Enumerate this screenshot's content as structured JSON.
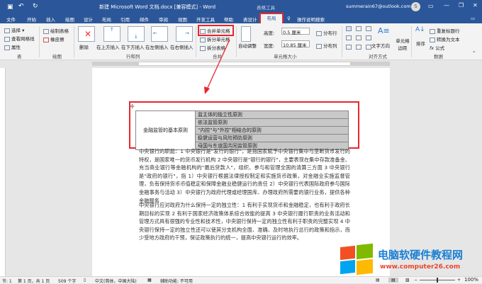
{
  "title_bar": {
    "document_title": "新建 Microsoft Word 文档.docx [兼容模式] - Word",
    "context_tools": "表格工具",
    "account": "summerain67@outlook.com",
    "avatar_letter": "S"
  },
  "menu_tabs": [
    "文件",
    "开始",
    "插入",
    "绘图",
    "设计",
    "布局",
    "引用",
    "邮件",
    "审阅",
    "视图",
    "开发工具",
    "帮助",
    "表设计",
    "布局"
  ],
  "active_tab": "布局",
  "search_label": "操作说明搜索",
  "ribbon": {
    "table_group": {
      "label": "表",
      "items": [
        "选择",
        "查看网格线",
        "属性"
      ]
    },
    "draw_group": {
      "label": "绘图",
      "items": [
        "绘制表格",
        "橡皮擦"
      ]
    },
    "rows_cols_group": {
      "label": "行和列",
      "delete": "删除",
      "insert_above": "在上方插入",
      "insert_below": "在下方插入",
      "insert_left": "在左侧插入",
      "insert_right": "在右侧插入"
    },
    "merge_group": {
      "label": "合并",
      "merge_cells": "合并单元格",
      "split_cells": "拆分单元格",
      "split_table": "拆分表格"
    },
    "cell_size_group": {
      "label": "单元格大小",
      "autofit": "自动调整",
      "height_label": "高度:",
      "height_value": "0.5 厘米",
      "width_label": "宽度:",
      "width_value": "10.85 厘米",
      "distribute_rows": "分布行",
      "distribute_cols": "分布列"
    },
    "alignment_group": {
      "label": "对齐方式",
      "text_direction": "文字方向",
      "cell_margins": "单元格边距"
    },
    "data_group": {
      "label": "数据",
      "sort": "排序",
      "repeat_header": "重复标题行",
      "convert_text": "转换为文本",
      "formula": "公式"
    }
  },
  "table": {
    "left_cell": "金融监管的基本原则",
    "rows": [
      "监主体的独立性原则",
      "依法监管原则",
      "\"内控\"与\"外控\"相结合的原则",
      "稳健运营与风险预防原则",
      "母国与东道国共同监管原则"
    ]
  },
  "paragraphs": [
    "中央银行的职能：1 中央银行是\"发行的银行\"，是指国家赋予中央银行集中与垄断货币发行的特权，是国家唯一的货币发行机构 2 中央银行是\"银行的银行\"，主要表现在集中存款准备金、充当商业银行等金融机构的\"最后贷款人\"，组织、参与和管理全国的清算三方面 3 中央银行是\"政府的银行\"，指 1）中央银行根据法律授权制定和实施货币政策，对金融业实施监督管理，负有保持货币币值稳定和保障金融业稳健运行的责任 2）中央银行代表国际政府参与国际金融事务与活动 3）中央银行为政府代理或经理国库、办理政府所需要的银行业务，提供各种金融服务",
    "中央银行应对政府为什么保持一定的独立性：1 有利于实现货币和金融稳定，也有利于政府长期目标的实现 2 有利于国家经济政策体系综合效能的提高 3 中央银行履行职责的业务活动和管理方式具有很强的专业性和技术性，中央银行保持一定的独立性有利于职责的完整实现 4 中央银行保持一定的独立性还可以使其分支机构全面、准确、及时地执行总行的政策和指示，而少受地方政府的干预，保证政策执行的统一，提高中央银行运行的效率。"
  ],
  "status_bar": {
    "section": "节: 1",
    "page": "第 1 页，共 1 页",
    "words": "509 个字",
    "language": "中文(简体，中国大陆)",
    "accessibility": "辅助功能: 不可用",
    "zoom": "100%"
  },
  "watermark": {
    "title": "电脑软硬件教程网",
    "url": "www.computer26.com"
  },
  "colors": {
    "brand": "#2b579a",
    "highlight": "#e8262d"
  }
}
